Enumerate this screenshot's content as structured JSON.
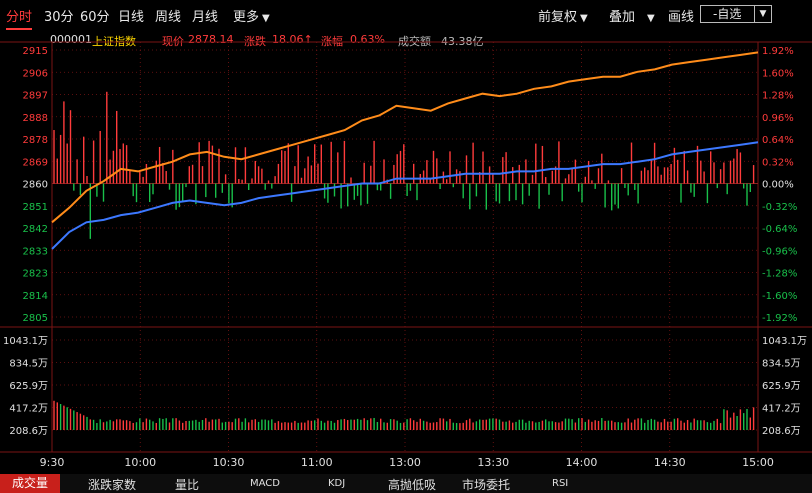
{
  "period_tabs": [
    "分时",
    "30分",
    "60分",
    "日线",
    "周线",
    "月线",
    "更多"
  ],
  "toolbar": {
    "adjust": "前复权",
    "overlay": "叠加",
    "draw": "画线",
    "watchlist": "-自选"
  },
  "info": {
    "code": "000001",
    "name": "上证指数",
    "price_label": "现价",
    "price": "2878.14",
    "change_label": "涨跌",
    "change": "18.06↑",
    "pct_label": "涨幅",
    "pct": "0.63%",
    "amount_label": "成交额",
    "amount": "43.38亿"
  },
  "bottom_tabs": [
    "成交量",
    "涨跌家数",
    "量比",
    "MACD",
    "KDJ",
    "高抛低吸",
    "市场委托",
    "RSI"
  ],
  "colors": {
    "up": "#ff3b3b",
    "down": "#19c04a",
    "price": "#ff8c1a",
    "avg": "#3c78ff",
    "grid": "#7a1414"
  },
  "chart_data": {
    "type": "line",
    "ticker_x": [
      "9:30",
      "10:00",
      "10:30",
      "11:00",
      "13:00",
      "13:30",
      "14:00",
      "14:30",
      "15:00"
    ],
    "y_left_ticks": [
      "2915",
      "2906",
      "2897",
      "2888",
      "2878",
      "2869",
      "2860",
      "2851",
      "2842",
      "2833",
      "2823",
      "2814",
      "2805"
    ],
    "y_right_ticks": [
      "1.92%",
      "1.60%",
      "1.28%",
      "0.96%",
      "0.64%",
      "0.32%",
      "0.00%",
      "-0.32%",
      "-0.64%",
      "-0.96%",
      "-1.28%",
      "-1.60%",
      "-1.92%"
    ],
    "prev_close": 2860,
    "ylim": [
      2805,
      2915
    ],
    "series": [
      {
        "name": "price",
        "values": [
          2844,
          2850,
          2857,
          2861,
          2866,
          2865,
          2867,
          2869,
          2872,
          2873,
          2871,
          2870,
          2872,
          2874,
          2876,
          2878,
          2880,
          2882,
          2886,
          2888,
          2892,
          2891,
          2890,
          2893,
          2895,
          2897,
          2896,
          2897,
          2899,
          2900,
          2902,
          2903,
          2904,
          2904,
          2906,
          2907,
          2909,
          2910,
          2911,
          2912,
          2913,
          2914
        ]
      },
      {
        "name": "avg",
        "values": [
          2833,
          2840,
          2844,
          2845,
          2847,
          2848,
          2850,
          2852,
          2853,
          2852,
          2851,
          2852,
          2854,
          2855,
          2856,
          2857,
          2858,
          2859,
          2860,
          2860,
          2862,
          2862,
          2862,
          2863,
          2864,
          2864,
          2864,
          2865,
          2865,
          2866,
          2866,
          2867,
          2868,
          2868,
          2869,
          2870,
          2872,
          2873,
          2874,
          2875,
          2876,
          2877
        ]
      }
    ],
    "volume_ticks": [
      "1043.1万",
      "834.5万",
      "625.9万",
      "417.2万",
      "208.6万"
    ],
    "volume_max": 1043.1
  }
}
